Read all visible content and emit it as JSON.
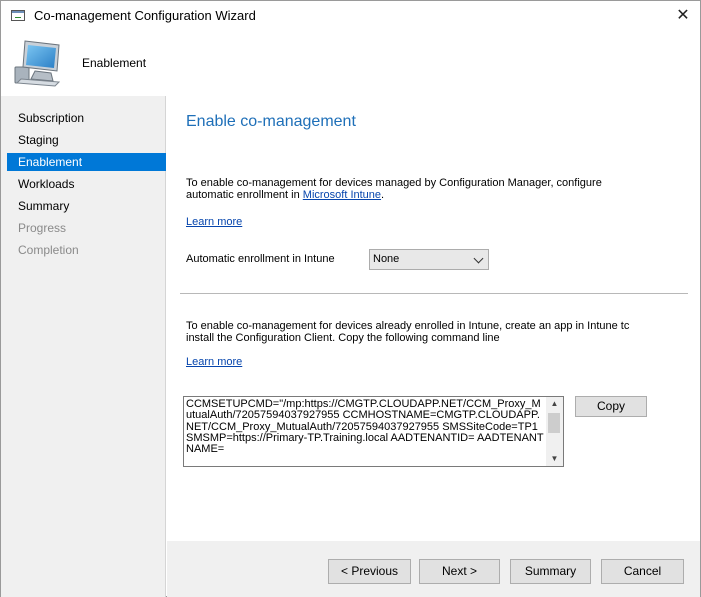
{
  "window": {
    "title": "Co-management Configuration Wizard",
    "close_glyph": "✕"
  },
  "header": {
    "title": "Enablement",
    "icon": "computer-icon"
  },
  "nav": {
    "items": [
      {
        "label": "Subscription",
        "state": "done"
      },
      {
        "label": "Staging",
        "state": "done"
      },
      {
        "label": "Enablement",
        "state": "active"
      },
      {
        "label": "Workloads",
        "state": "done"
      },
      {
        "label": "Summary",
        "state": "done"
      },
      {
        "label": "Progress",
        "state": "disabled"
      },
      {
        "label": "Completion",
        "state": "disabled"
      }
    ]
  },
  "main": {
    "title": "Enable co-management",
    "intro_text": "To enable co-management for devices managed by Configuration Manager, configure automatic enrollment in ",
    "intro_link": "Microsoft Intune",
    "intro_end": ".",
    "learn_more_1": "Learn more",
    "dropdown_label": "Automatic enrollment in Intune",
    "dropdown_value": "None",
    "intune_line1": "To enable co-management for devices already enrolled in Intune, create an app in Intune tc",
    "intune_line2": "install the Configuration Client. Copy the following command line",
    "learn_more_2": "Learn more",
    "command_line": "CCMSETUPCMD=\"/mp:https://CMGTP.CLOUDAPP.NET/CCM_Proxy_MutualAuth/72057594037927955 CCMHOSTNAME=CMGTP.CLOUDAPP.NET/CCM_Proxy_MutualAuth/72057594037927955 SMSSiteCode=TP1 SMSMP=https://Primary-TP.Training.local AADTENANTID= AADTENANTNAME=",
    "copy_label": "Copy"
  },
  "footer": {
    "previous_label": "< Previous",
    "next_label": "Next >",
    "summary_label": "Summary",
    "cancel_label": "Cancel"
  },
  "colors": {
    "accent": "#0078d7",
    "title_blue": "#1e6fb8",
    "link": "#0645ad"
  }
}
